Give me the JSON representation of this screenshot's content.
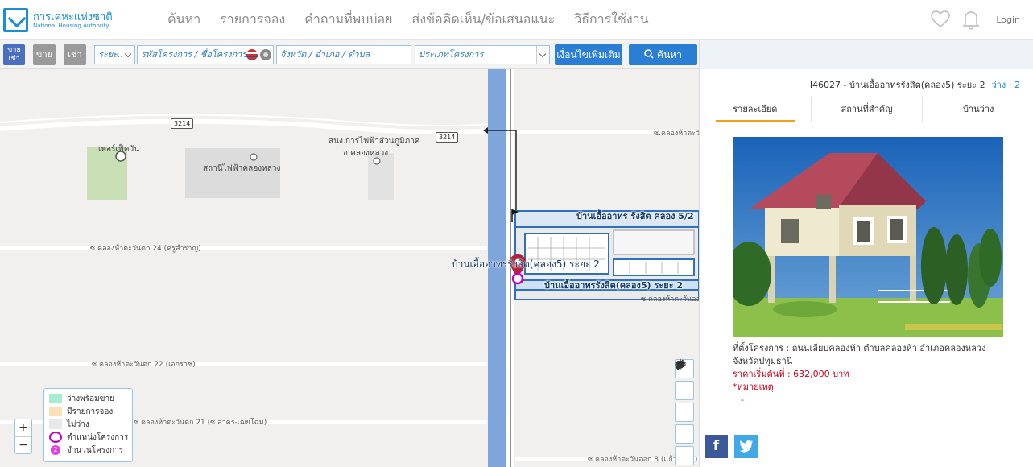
{
  "header": {
    "logo_th": "การเคหะแห่งชาติ",
    "logo_en": "National Housing Authority",
    "menu": [
      "ค้นหา",
      "รายการจอง",
      "คำถามที่พบบ่อย",
      "ส่งข้อคิดเห็น/ข้อเสนอแนะ",
      "วิธีการใช้งาน"
    ],
    "login": "Login"
  },
  "search": {
    "sale_rent_label": "ขาย เช่า",
    "sale_label": "ขาย",
    "rent_label": "เช่า",
    "phase_value": "ระยะ...",
    "project_placeholder": "รหัสโครงการ / ชื่อโครงการ",
    "area_placeholder": "จังหวัด / อำเภอ / ตำบล",
    "type_value": "ประเภทโครงการ",
    "more_conditions": "เงื่อนไขเพิ่มเติม",
    "search_button": "ค้นหา"
  },
  "map": {
    "labels": {
      "police": "เพอร์เฟ็ควัน",
      "station": "สถานีไฟฟ้าคลองหลวง",
      "pea": "สนง.การไฟฟ้าส่วนภูมิภาค",
      "pea2": "อ.คลองหลวง",
      "rd_top": "ซ.คลองห้าตะวันตก",
      "rd24": "ซ.คลองห้าตะวันตก 24 (ครูสำราญ)",
      "rd22": "ซ.คลองห้าตะวันตก 22 (เอกราช)",
      "rd21": "ซ.คลองห้าตะวันตก 21 (ซ.สาคร-เฌยโฉม)",
      "rd_east": "ซ.คลองห้าตะวันออก",
      "rd8": "ซ.คลองห้าตะวันออก 8 (แก้วพลอย)",
      "road1": "3214",
      "road2": "3214",
      "proj_top": "บ้านเอื้ออาทร รังสิต คลอง 5/2",
      "marker": "บ้านเอื้ออาทรรังสิต(คลอง5) ระยะ 2",
      "proj_bottom": "บ้านเอื้ออาทรรังสิต(คลอง5) ระยะ 2"
    },
    "legend": [
      {
        "label": "ว่างพร้อมขาย",
        "color": "#a8ecd2"
      },
      {
        "label": "มีรายการจอง",
        "color": "#fbe0b8"
      },
      {
        "label": "ไม่ว่าง",
        "color": "#e8e8e8"
      },
      {
        "label": "ตำแหน่งโครงการ",
        "color": "#c800c8"
      },
      {
        "label": "จำนวนโครงการ",
        "color": "#e040e0",
        "count": "2"
      }
    ],
    "zoom_in": "+",
    "zoom_out": "−"
  },
  "project": {
    "title": "I46027 - บ้านเอื้ออาทรรังสิต(คลอง5) ระยะ 2",
    "available": "ว่าง : 2",
    "tabs": [
      "รายละเอียด",
      "สถานที่สำคัญ",
      "บ้านว่าง"
    ],
    "location": "ที่ตั้งโครงการ : ถนนเลียบคลองห้า ตำบลคลองห้า อำเภอคลองหลวง จังหวัดปทุมธานี",
    "price": "ราคาเริ่มต้นที่ : 632,000 บาท",
    "note_label": "*หมายเหตุ",
    "note_value": "-",
    "facebook": "f"
  },
  "colors": {
    "accent": "#1a8fd6",
    "tab_active": "#f0a11a",
    "price": "#d0021b",
    "sale_btn": "#4a6fc1",
    "rent_btn": "#9a9a9a"
  }
}
